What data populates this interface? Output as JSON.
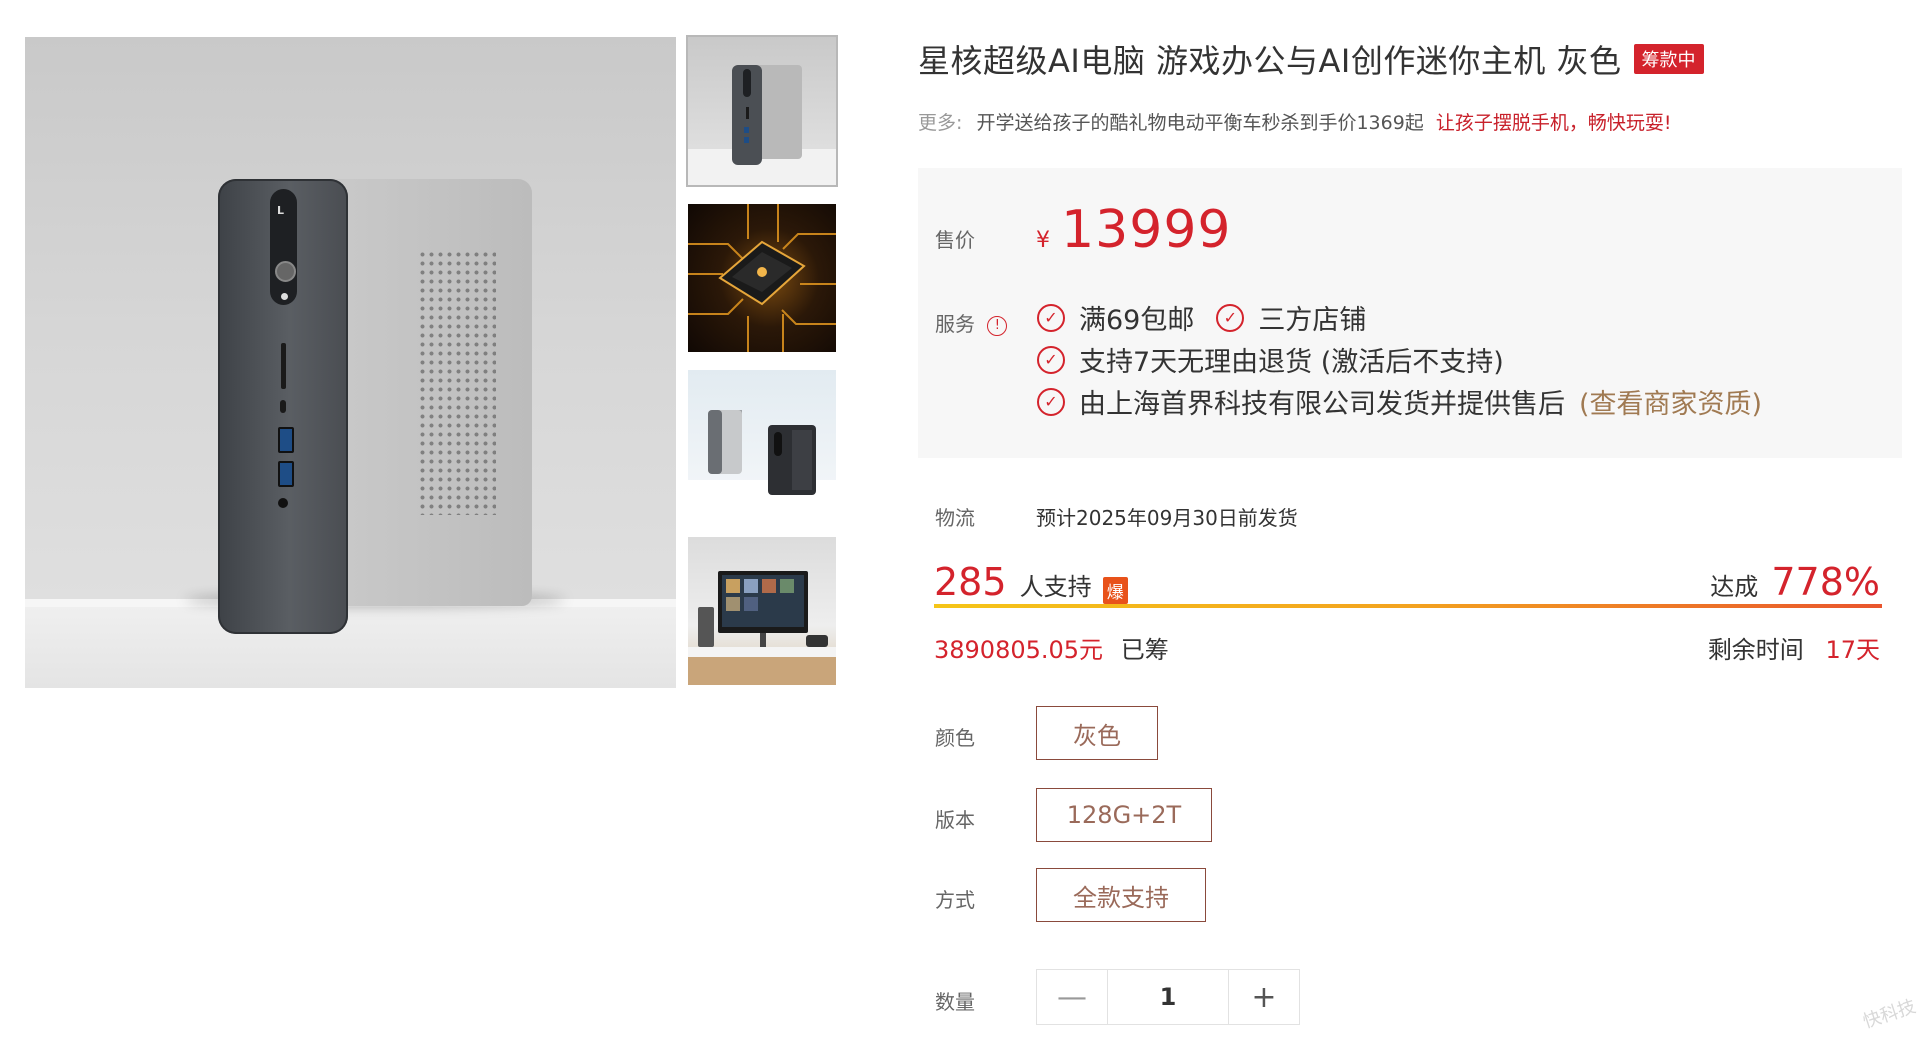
{
  "product": {
    "title": "星核超级AI电脑 游戏办公与AI创作迷你主机 灰色",
    "status_badge": "筹款中"
  },
  "promo": {
    "label": "更多:",
    "text": "开学送给孩子的酷礼物电动平衡车秒杀到手价1369起",
    "link": "让孩子摆脱手机，畅快玩耍!"
  },
  "price": {
    "label": "售价",
    "currency": "¥",
    "amount": "13999"
  },
  "services": {
    "label": "服务",
    "items": [
      "满69包邮",
      "三方店铺",
      "支持7天无理由退货 (激活后不支持)",
      "由上海首界科技有限公司发货并提供售后"
    ],
    "merchant_link": "(查看商家资质)"
  },
  "logistics": {
    "label": "物流",
    "text": "预计2025年09月30日前发货"
  },
  "funding": {
    "supporters": "285",
    "supporters_unit": "人支持",
    "hot_badge": "爆",
    "reach_label": "达成",
    "reach_percent": "778%",
    "progress": 1.0,
    "raised_amount": "3890805.05元",
    "raised_suffix": "已筹",
    "remaining_label": "剩余时间",
    "remaining_days": "17天"
  },
  "options": {
    "color": {
      "label": "颜色",
      "value": "灰色"
    },
    "version": {
      "label": "版本",
      "value": "128G+2T"
    },
    "method": {
      "label": "方式",
      "value": "全款支持"
    }
  },
  "quantity": {
    "label": "数量",
    "value": "1",
    "minus": "—",
    "plus": "+"
  },
  "colors": {
    "accent": "#d4232c",
    "merchant": "#a07a52",
    "option_border": "#8a4a3c"
  }
}
